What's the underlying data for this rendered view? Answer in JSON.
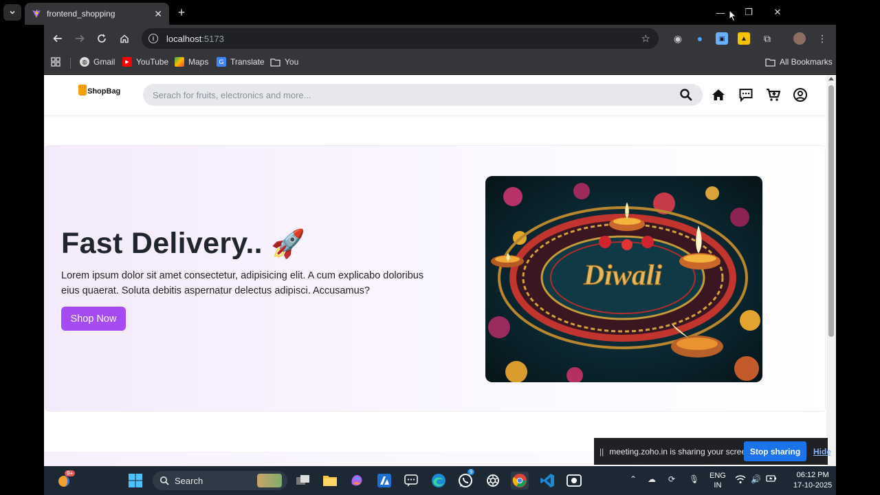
{
  "browser": {
    "tab_title": "frontend_shopping",
    "url_host": "localhost",
    "url_port": ":5173",
    "bookmarks": [
      "Gmail",
      "YouTube",
      "Maps",
      "Translate",
      "You"
    ],
    "all_bookmarks": "All Bookmarks"
  },
  "header": {
    "logo_text": "ShopBag",
    "search_placeholder": "Serach for fruits, electronics and more..."
  },
  "hero": {
    "title": "Fast Delivery..",
    "title_emoji": "🚀",
    "description": "Lorem ipsum dolor sit amet consectetur, adipisicing elit. A cum explicabo doloribus eius quaerat. Soluta debitis aspernatur delectus adipisci. Accusamus?",
    "button_label": "Shop Now",
    "image_text": "Diwali",
    "accent_color": "#a64bf4"
  },
  "share_banner": {
    "text": "meeting.zoho.in is sharing your screen.",
    "stop_label": "Stop sharing",
    "hide_label": "Hide"
  },
  "taskbar": {
    "weather_badge": "9+",
    "search_label": "Search",
    "whatsapp_badge": "9",
    "lang_line1": "ENG",
    "lang_line2": "IN",
    "time": "06:12 PM",
    "date": "17-10-2025"
  }
}
